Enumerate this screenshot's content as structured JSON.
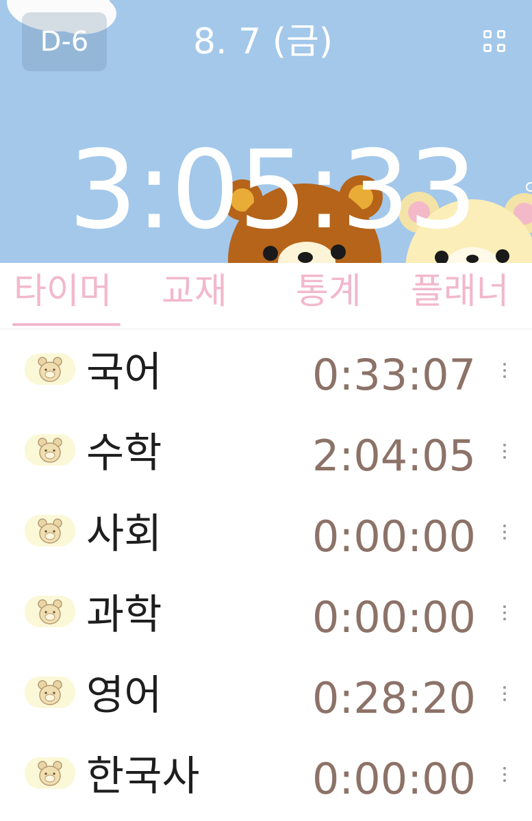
{
  "header": {
    "dday": "D-6",
    "date": "8. 7 (금)",
    "timer": "3:05:33",
    "grid_icon": "grid-icon",
    "colors": {
      "sky": "#a3c8ea",
      "white": "#ffffff"
    }
  },
  "tabs": [
    {
      "label": "타이머",
      "active": true
    },
    {
      "label": "교재",
      "active": false
    },
    {
      "label": "통계",
      "active": false
    },
    {
      "label": "플래너",
      "active": false
    }
  ],
  "subjects": [
    {
      "name": "국어",
      "time": "0:33:07",
      "icon": "bear-icon"
    },
    {
      "name": "수학",
      "time": "2:04:05",
      "icon": "bear-icon"
    },
    {
      "name": "사회",
      "time": "0:00:00",
      "icon": "bear-icon"
    },
    {
      "name": "과학",
      "time": "0:00:00",
      "icon": "bear-icon"
    },
    {
      "name": "영어",
      "time": "0:28:20",
      "icon": "bear-icon"
    },
    {
      "name": "한국사",
      "time": "0:00:00",
      "icon": "bear-icon"
    }
  ],
  "theme": {
    "accent_pink": "#f2b8cd",
    "time_brown": "#8c7267",
    "icon_bg": "#fbf8d8"
  }
}
